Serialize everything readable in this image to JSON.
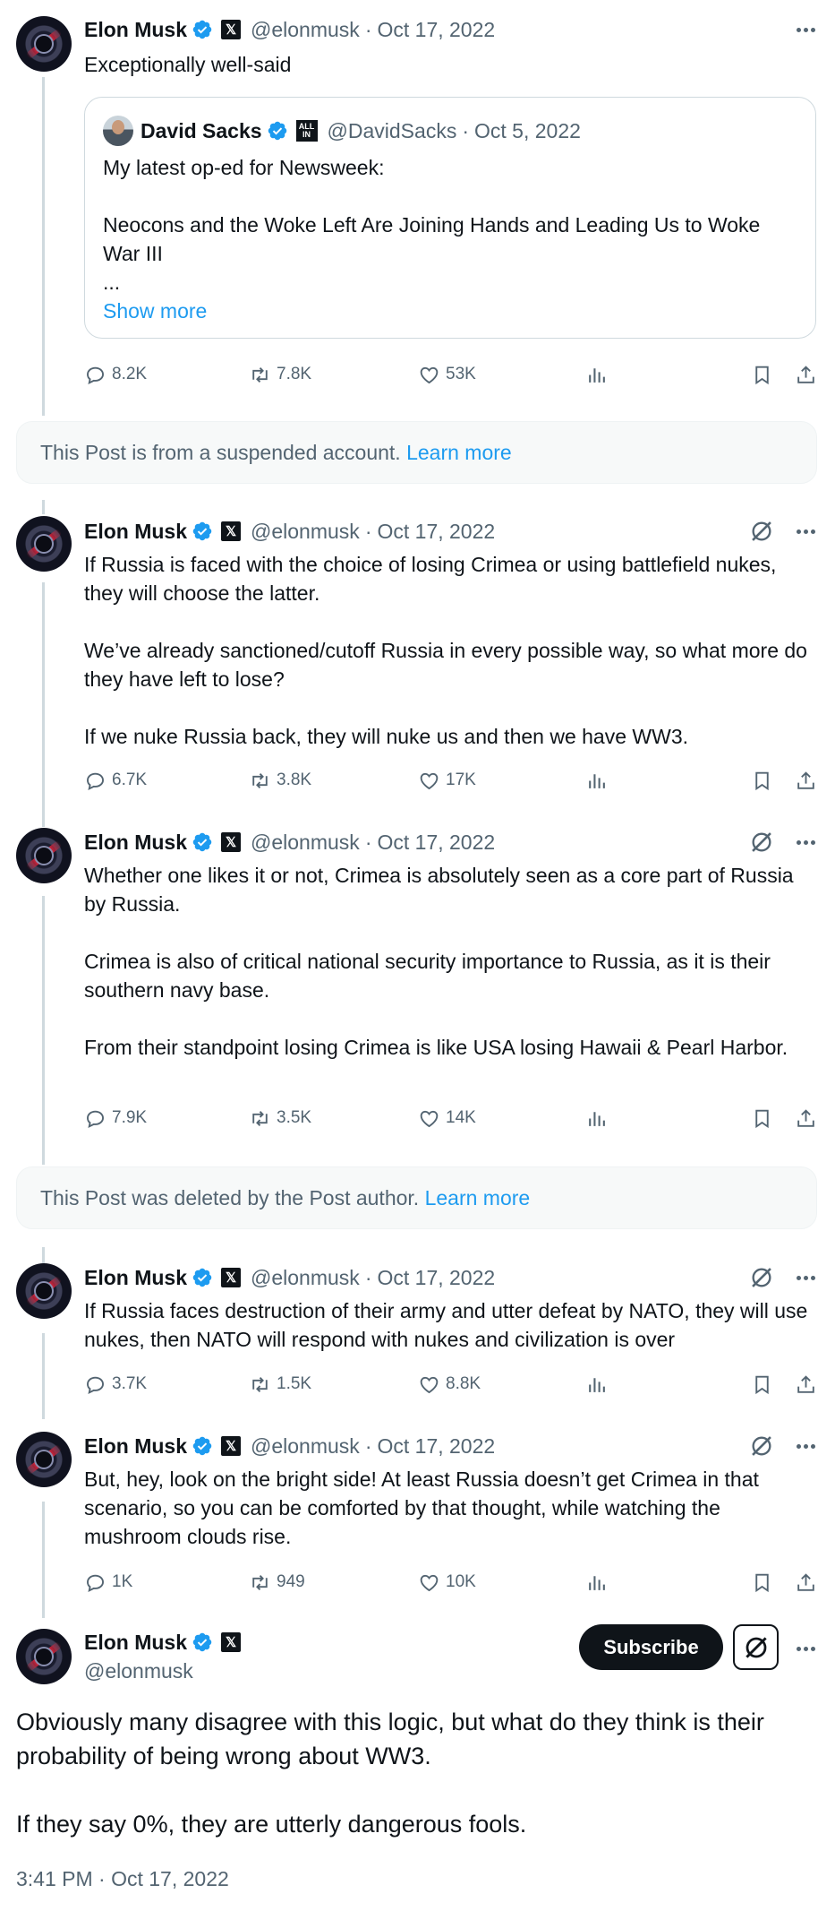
{
  "tweets": [
    {
      "name": "Elon Musk",
      "handle": "@elonmusk",
      "date": "Oct 17, 2022",
      "text": [
        "Exceptionally well-said"
      ],
      "quote": {
        "name": "David Sacks",
        "handle": "@DavidSacks",
        "date": "Oct 5, 2022",
        "line1": "My latest op-ed for Newsweek:",
        "line2": "Neocons and the Woke Left Are Joining Hands and Leading Us to Woke War III",
        "ellipsis": "...",
        "show_more": "Show more"
      },
      "replies": "8.2K",
      "reposts": "7.8K",
      "likes": "53K"
    },
    {
      "name": "Elon Musk",
      "handle": "@elonmusk",
      "date": "Oct 17, 2022",
      "text": [
        "If Russia is faced with the choice of losing Crimea or using battlefield nukes, they will choose the latter.",
        "We’ve already sanctioned/cutoff Russia in every possible way, so what more do they have left to lose?",
        "If we nuke Russia back, they will nuke us and then we have WW3."
      ],
      "replies": "6.7K",
      "reposts": "3.8K",
      "likes": "17K"
    },
    {
      "name": "Elon Musk",
      "handle": "@elonmusk",
      "date": "Oct 17, 2022",
      "text": [
        "Whether one likes it or not, Crimea is absolutely seen as a core part of Russia by Russia.",
        "Crimea is also of critical national security importance to Russia, as it is their southern navy base.",
        "From their standpoint losing Crimea is like USA losing Hawaii & Pearl Harbor."
      ],
      "replies": "7.9K",
      "reposts": "3.5K",
      "likes": "14K"
    },
    {
      "name": "Elon Musk",
      "handle": "@elonmusk",
      "date": "Oct 17, 2022",
      "text": [
        "If Russia faces destruction of their army and utter defeat by NATO, they will use nukes, then NATO will respond with nukes and civilization is over"
      ],
      "replies": "3.7K",
      "reposts": "1.5K",
      "likes": "8.8K"
    },
    {
      "name": "Elon Musk",
      "handle": "@elonmusk",
      "date": "Oct 17, 2022",
      "text": [
        "But, hey, look on the bright side! At least Russia doesn’t get Crimea in that scenario, so you can be comforted by that thought, while watching the mushroom clouds rise."
      ],
      "replies": "1K",
      "reposts": "949",
      "likes": "10K"
    }
  ],
  "notices": {
    "suspended": "This Post is from a suspended account.",
    "deleted": "This Post was deleted by the Post author.",
    "learn_more": "Learn more"
  },
  "main": {
    "name": "Elon Musk",
    "handle": "@elonmusk",
    "subscribe_label": "Subscribe",
    "text": [
      "Obviously many disagree with this logic, but what do they think is their probability of being wrong about WW3.",
      "If they say 0%, they are utterly dangerous fools."
    ],
    "timestamp": "3:41 PM · Oct 17, 2022"
  },
  "colors": {
    "accent": "#1d9bf0",
    "text": "#0f1419",
    "muted": "#536471",
    "border": "#cfd9de"
  },
  "icons": [
    "verified-badge-icon",
    "x-logo-icon",
    "more-icon",
    "grok-icon",
    "reply-icon",
    "repost-icon",
    "like-icon",
    "views-icon",
    "bookmark-icon",
    "share-icon"
  ]
}
